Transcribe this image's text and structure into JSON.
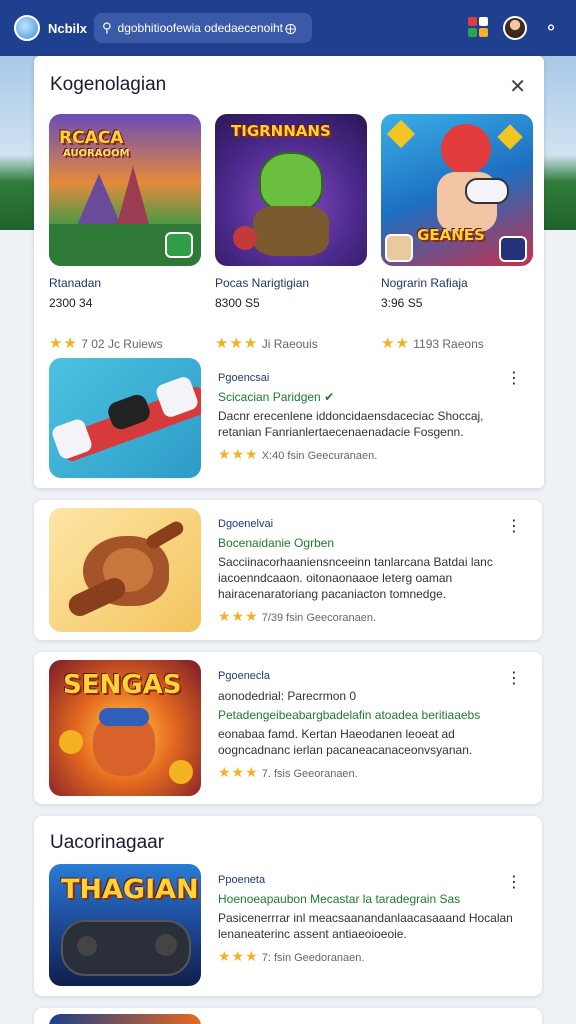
{
  "app": {
    "name": "Ncbilx"
  },
  "search": {
    "text": "dgobhitioofewia odedaecenoiht"
  },
  "colors": {
    "topbar": "#1f3f8f",
    "accent": "#1f7a2e",
    "star": "#f2b221"
  },
  "sheet": {
    "title": "Kogenolagian",
    "close_icon": "close-icon",
    "featured": [
      {
        "name": "Rtanadan",
        "price": "2300 34",
        "stars": "★★",
        "rating_text": "7 02  Jc Ruiews",
        "art_text": "RCACA\nAUORAOOM"
      },
      {
        "name": "Pocas Narigtigian",
        "price": "8300 S5",
        "stars": "★★★",
        "rating_text": "Ji Raeouis",
        "art_text": "TIGRNNANS"
      },
      {
        "name": "Nograrin Rafiaja",
        "price": "3:96 S5",
        "stars": "★★",
        "rating_text": "1193 Raeons",
        "art_text": "GEANES"
      }
    ]
  },
  "list": [
    {
      "category": "Pgoencsai",
      "developer": "Scicacian Paridgen",
      "description": "Dacnr erecenlene iddoncidaensdaceciac Shoccaj, retanian Fanrianlertaecenaenadacie Fosgenn.",
      "stars": "★★★",
      "rating_text": "X:40 fsin  Geecuranaen."
    },
    {
      "category": "Dgoenelvai",
      "developer": "Bocenaidanie Ogrben",
      "description": "Sacciinacorhaaniensnceeinn tanlarcana Batdai lanc iacoenndcaaon. oitonaonaaoe leterg oaman hairacenaratoriang pacaniacton tomnedge.",
      "stars": "★★★",
      "rating_text": "7/39 fsin  Geecoranaen."
    },
    {
      "category": "Pgoenecla",
      "developer": "Petadengeibeabargbadelafin atoadea beritiaaebs",
      "description": "eonabaa famd. Kertan Haeodanen leoeat ad oogncadnanc ierlan pacaneacanaceonvsyanan.",
      "stars": "★★★",
      "rating_text": "7. fsis  Geeoranaen.",
      "sub_line": "aonodedrial: Parecrmon 0"
    }
  ],
  "section2": {
    "title": "Uacorinagaar",
    "item": {
      "category": "Ppoeneta",
      "developer": "Hoenoeapaubon Mecastar la taradegrain Sas",
      "description": "Pasicenerrrar inl meacsaanandanlaacasaaand Hocalan lenaneaterinc assent antiaeoioeoie.",
      "stars": "★★★",
      "rating_text": "7: fsin  Geedoranaen.",
      "art_text": "THAGIAN"
    }
  },
  "art": {
    "card1_game": "controller-plane",
    "card2_game": "lion-cat",
    "card3_game": "SENGAS"
  }
}
